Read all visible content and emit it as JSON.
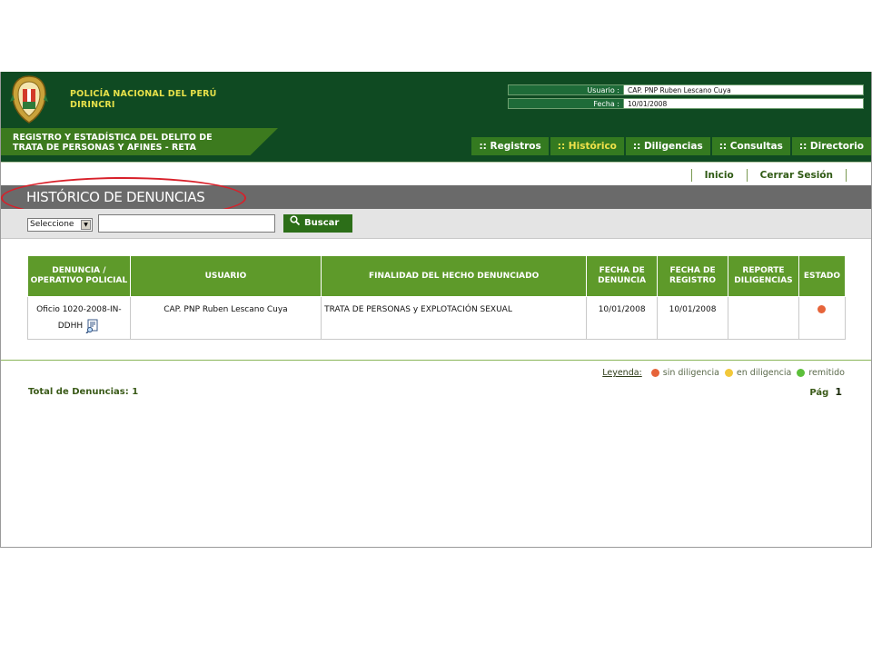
{
  "header": {
    "org_line1": "POLICÍA NACIONAL DEL PERÚ",
    "org_line2": "DIRINCRI",
    "user_label": "Usuario :",
    "user_value": "CAP. PNP  Ruben Lescano Cuya",
    "date_label": "Fecha :",
    "date_value": "10/01/2008"
  },
  "system": {
    "title_line1": "REGISTRO Y ESTADÍSTICA DEL DELITO DE",
    "title_line2": "TRATA DE PERSONAS Y AFINES - RETA"
  },
  "nav": [
    {
      "label": ":: Registros",
      "active": false
    },
    {
      "label": ":: Histórico",
      "active": true
    },
    {
      "label": ":: Diligencias",
      "active": false
    },
    {
      "label": ":: Consultas",
      "active": false
    },
    {
      "label": ":: Directorio",
      "active": false
    }
  ],
  "top_links": {
    "home": "Inicio",
    "logout": "Cerrar Sesión"
  },
  "section_title": "HISTÓRICO DE DENUNCIAS",
  "search": {
    "select_value": "Seleccione",
    "button_label": "Buscar",
    "input_value": ""
  },
  "table": {
    "headers": [
      "DENUNCIA / OPERATIVO POLICIAL",
      "USUARIO",
      "FINALIDAD DEL HECHO DENUNCIADO",
      "FECHA DE DENUNCIA",
      "FECHA DE REGISTRO",
      "REPORTE DILIGENCIAS",
      "ESTADO"
    ],
    "rows": [
      {
        "denuncia": "Oficio 1020-2008-IN-DDHH",
        "usuario": "CAP. PNP Ruben Lescano Cuya",
        "finalidad": "TRATA DE PERSONAS y EXPLOTACIÓN SEXUAL",
        "fecha_denuncia": "10/01/2008",
        "fecha_registro": "10/01/2008",
        "reporte": "",
        "estado": "sin diligencia"
      }
    ]
  },
  "legend": {
    "label": "Leyenda:",
    "items": [
      {
        "label": "sin diligencia",
        "color": "#e6643a"
      },
      {
        "label": "en diligencia",
        "color": "#f2c83a"
      },
      {
        "label": "remitido",
        "color": "#5cbf3a"
      }
    ]
  },
  "footer": {
    "total_label": "Total de Denuncias: 1",
    "page_label": "Pág",
    "page_number": "1"
  }
}
